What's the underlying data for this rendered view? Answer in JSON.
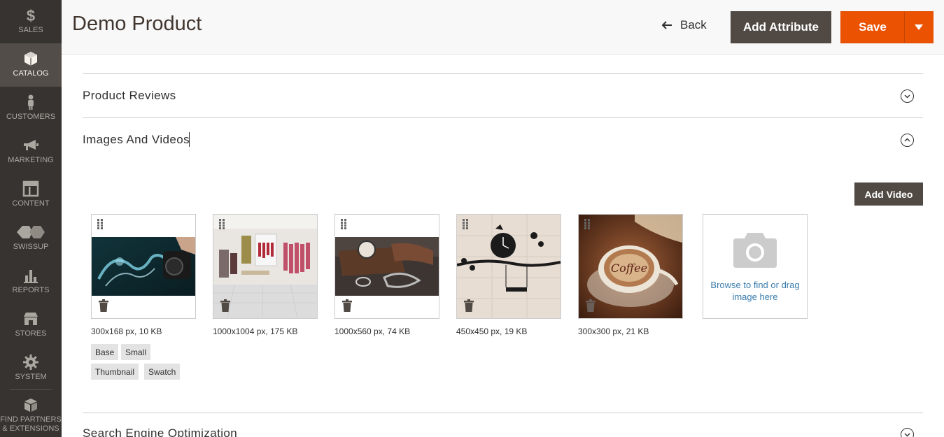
{
  "sidebar": {
    "items": [
      {
        "label": "SALES",
        "icon": "dollar-icon"
      },
      {
        "label": "CATALOG",
        "icon": "cube-icon",
        "active": true
      },
      {
        "label": "CUSTOMERS",
        "icon": "person-icon"
      },
      {
        "label": "MARKETING",
        "icon": "megaphone-icon"
      },
      {
        "label": "CONTENT",
        "icon": "layout-icon"
      },
      {
        "label": "SWISSUP",
        "icon": "swissup-icon"
      },
      {
        "label": "REPORTS",
        "icon": "bar-chart-icon"
      },
      {
        "label": "STORES",
        "icon": "store-icon"
      },
      {
        "label": "SYSTEM",
        "icon": "gear-icon"
      },
      {
        "label": "FIND PARTNERS & EXTENSIONS",
        "icon": "boxes-icon"
      }
    ]
  },
  "header": {
    "title": "Demo Product",
    "back_label": "Back",
    "add_attribute_label": "Add Attribute",
    "save_label": "Save"
  },
  "sections": {
    "reviews_title": "Product Reviews",
    "images_title": "Images And Videos",
    "seo_title": "Search Engine Optimization"
  },
  "images": {
    "add_video_label": "Add Video",
    "tiles": [
      {
        "meta": "300x168 px, 10 KB"
      },
      {
        "meta": "1000x1004 px, 175 KB"
      },
      {
        "meta": "1000x560 px, 74 KB"
      },
      {
        "meta": "450x450 px, 19 KB"
      },
      {
        "meta": "300x300 px, 21 KB"
      }
    ],
    "roles": [
      "Base",
      "Small",
      "Thumbnail",
      "Swatch"
    ],
    "uploader_text": "Browse to find or drag image here"
  },
  "colors": {
    "sidebar_bg": "#373330",
    "active_bg": "#524d49",
    "primary": "#eb5202",
    "secondary": "#514943",
    "link": "#3a7dae"
  }
}
